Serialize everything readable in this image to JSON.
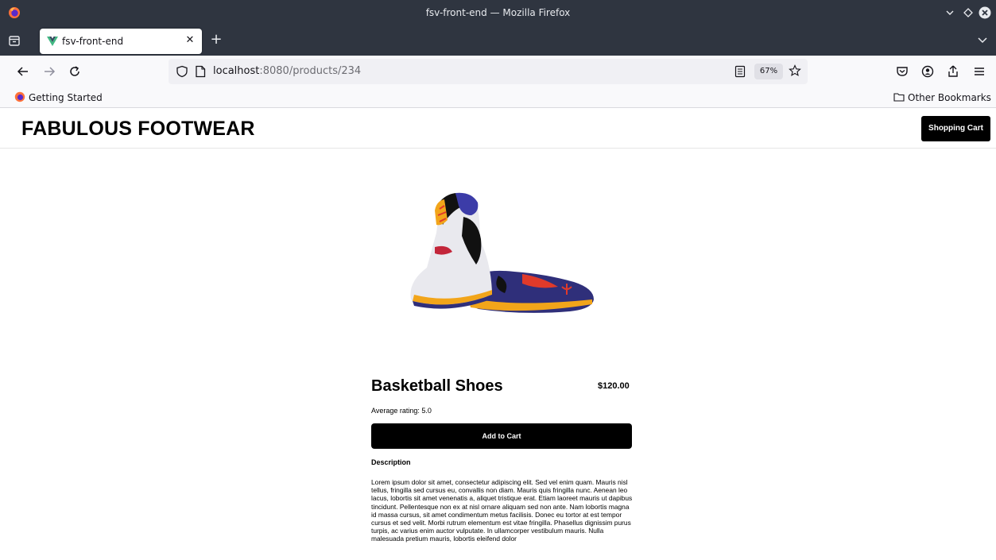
{
  "window": {
    "title": "fsv-front-end — Mozilla Firefox"
  },
  "tabs": [
    {
      "label": "fsv-front-end",
      "favicon": "vue-logo-icon",
      "active": true
    }
  ],
  "navbar": {
    "url_host": "localhost",
    "url_rest": ":8080/products/234",
    "zoom": "67%"
  },
  "bookmarks": {
    "getting_started": "Getting Started",
    "other": "Other Bookmarks"
  },
  "site": {
    "title": "FABULOUS FOOTWEAR",
    "cart_label": "Shopping Cart"
  },
  "product": {
    "name": "Basketball Shoes",
    "price": "$120.00",
    "rating": "Average rating: 5.0",
    "add_label": "Add to Cart",
    "description_title": "Description",
    "description": "Lorem ipsum dolor sit amet, consectetur adipiscing elit. Sed vel enim quam. Mauris nisl tellus, fringilla sed cursus eu, convallis non diam. Mauris quis fringilla nunc. Aenean leo lacus, lobortis sit amet venenatis a, aliquet tristique erat. Etiam laoreet mauris ut dapibus tincidunt. Pellentesque non ex at nisl ornare aliquam sed non ante. Nam lobortis magna id massa cursus, sit amet condimentum metus facilisis. Donec eu tortor at est tempor cursus et sed velit. Morbi rutrum elementum est vitae fringilla. Phasellus dignissim purus turpis, ac varius enim auctor vulputate. In ullamcorper vestibulum mauris. Nulla malesuada pretium mauris, lobortis eleifend dolor"
  },
  "colors": {
    "chrome_dark": "#2f3540",
    "toolbar": "#f9f9fb",
    "button_black": "#000000"
  }
}
